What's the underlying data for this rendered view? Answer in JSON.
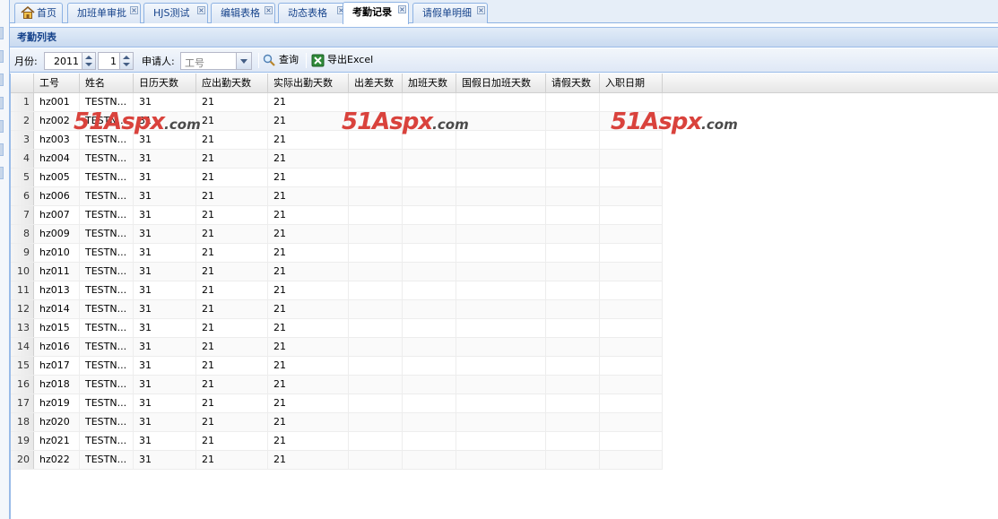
{
  "tabs": [
    {
      "label": "首页",
      "active": false,
      "closable": false
    },
    {
      "label": "加班单审批",
      "active": false,
      "closable": true
    },
    {
      "label": "HJS测试",
      "active": false,
      "closable": true
    },
    {
      "label": "编辑表格",
      "active": false,
      "closable": true
    },
    {
      "label": "动态表格",
      "active": false,
      "closable": true
    },
    {
      "label": "考勤记录",
      "active": true,
      "closable": true
    },
    {
      "label": "请假单明细",
      "active": false,
      "closable": true
    }
  ],
  "panel": {
    "title": "考勤列表"
  },
  "toolbar": {
    "month_label": "月份:",
    "year_value": "2011",
    "month_value": "1",
    "applicant_label": "申请人:",
    "applicant_placeholder": "工号",
    "query_label": "查询",
    "export_label": "导出Excel"
  },
  "grid": {
    "columns": [
      "工号",
      "姓名",
      "日历天数",
      "应出勤天数",
      "实际出勤天数",
      "出差天数",
      "加班天数",
      "国假日加班天数",
      "请假天数",
      "入职日期"
    ],
    "rows": [
      {
        "n": "1",
        "id": "hz001",
        "name": "TESTN...",
        "cal": "31",
        "due": "21",
        "actual": "21"
      },
      {
        "n": "2",
        "id": "hz002",
        "name": "TESTN...",
        "cal": "31",
        "due": "21",
        "actual": "21"
      },
      {
        "n": "3",
        "id": "hz003",
        "name": "TESTN...",
        "cal": "31",
        "due": "21",
        "actual": "21"
      },
      {
        "n": "4",
        "id": "hz004",
        "name": "TESTN...",
        "cal": "31",
        "due": "21",
        "actual": "21"
      },
      {
        "n": "5",
        "id": "hz005",
        "name": "TESTN...",
        "cal": "31",
        "due": "21",
        "actual": "21"
      },
      {
        "n": "6",
        "id": "hz006",
        "name": "TESTN...",
        "cal": "31",
        "due": "21",
        "actual": "21"
      },
      {
        "n": "7",
        "id": "hz007",
        "name": "TESTN...",
        "cal": "31",
        "due": "21",
        "actual": "21"
      },
      {
        "n": "8",
        "id": "hz009",
        "name": "TESTN...",
        "cal": "31",
        "due": "21",
        "actual": "21"
      },
      {
        "n": "9",
        "id": "hz010",
        "name": "TESTN...",
        "cal": "31",
        "due": "21",
        "actual": "21"
      },
      {
        "n": "10",
        "id": "hz011",
        "name": "TESTN...",
        "cal": "31",
        "due": "21",
        "actual": "21"
      },
      {
        "n": "11",
        "id": "hz013",
        "name": "TESTN...",
        "cal": "31",
        "due": "21",
        "actual": "21"
      },
      {
        "n": "12",
        "id": "hz014",
        "name": "TESTN...",
        "cal": "31",
        "due": "21",
        "actual": "21"
      },
      {
        "n": "13",
        "id": "hz015",
        "name": "TESTN...",
        "cal": "31",
        "due": "21",
        "actual": "21"
      },
      {
        "n": "14",
        "id": "hz016",
        "name": "TESTN...",
        "cal": "31",
        "due": "21",
        "actual": "21"
      },
      {
        "n": "15",
        "id": "hz017",
        "name": "TESTN...",
        "cal": "31",
        "due": "21",
        "actual": "21"
      },
      {
        "n": "16",
        "id": "hz018",
        "name": "TESTN...",
        "cal": "31",
        "due": "21",
        "actual": "21"
      },
      {
        "n": "17",
        "id": "hz019",
        "name": "TESTN...",
        "cal": "31",
        "due": "21",
        "actual": "21"
      },
      {
        "n": "18",
        "id": "hz020",
        "name": "TESTN...",
        "cal": "31",
        "due": "21",
        "actual": "21"
      },
      {
        "n": "19",
        "id": "hz021",
        "name": "TESTN...",
        "cal": "31",
        "due": "21",
        "actual": "21"
      },
      {
        "n": "20",
        "id": "hz022",
        "name": "TESTN...",
        "cal": "31",
        "due": "21",
        "actual": "21"
      }
    ]
  },
  "watermark": {
    "big": "51Aspx",
    "small": ".com"
  },
  "colors": {
    "accent": "#15428b",
    "border": "#99bbe8",
    "watermark_red": "#d9423c"
  },
  "icons": {
    "home": "home-icon",
    "close": "close-icon",
    "query": "magnifier-icon",
    "export": "excel-icon"
  }
}
